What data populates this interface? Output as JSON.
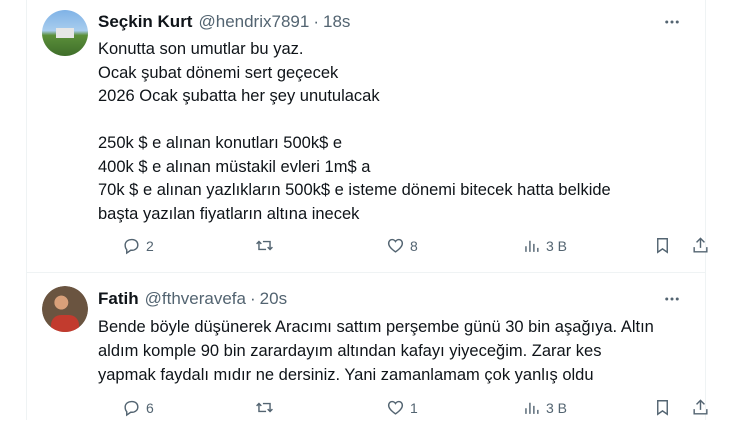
{
  "tweets": [
    {
      "author": "Seçkin Kurt",
      "handle": "@hendrix7891",
      "separator": "·",
      "time": "18s",
      "lines": [
        "Konutta son umutlar bu yaz.",
        "Ocak şubat dönemi sert geçecek",
        "2026 Ocak şubatta her şey unutulacak",
        "",
        "250k $ e alınan konutları 500k$ e",
        "400k $ e alınan müstakil evleri 1m$ a",
        "70k $ e alınan yazlıkların 500k$ e isteme dönemi bitecek hatta belkide",
        "başta yazılan fiyatların altına inecek"
      ],
      "stats": {
        "replies": "2",
        "reposts": "",
        "likes": "8",
        "views": "3 B"
      }
    },
    {
      "author": "Fatih",
      "handle": "@fthveravefa",
      "separator": "·",
      "time": "20s",
      "lines": [
        "Bende böyle düşünerek Aracımı sattım perşembe günü 30 bin aşağıya. Altın",
        "aldım komple 90 bin zarardayım altından kafayı yiyeceğim. Zarar kes",
        "yapmak faydalı mıdır ne dersiniz. Yani zamanlamam çok yanlış oldu"
      ],
      "stats": {
        "replies": "6",
        "reposts": "",
        "likes": "1",
        "views": "3 B"
      }
    }
  ],
  "icons": {
    "reply": "reply-icon",
    "repost": "repost-icon",
    "like": "like-icon",
    "views": "views-icon",
    "bookmark": "bookmark-icon",
    "share": "share-icon",
    "more": "more-icon"
  },
  "colors": {
    "text": "#0f1419",
    "secondary": "#536471",
    "divider": "#eff3f4"
  }
}
